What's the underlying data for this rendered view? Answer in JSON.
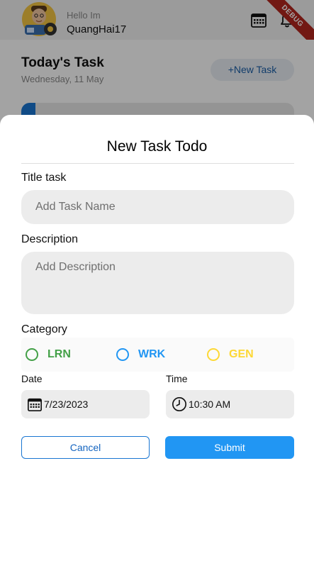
{
  "header": {
    "greeting": "Hello Im",
    "username": "QuangHai17",
    "debug_banner": "DEBUG",
    "icons": [
      "calendar-icon",
      "bell-icon"
    ]
  },
  "home": {
    "title": "Today's Task",
    "date": "Wednesday, 11 May",
    "new_task_label": "+New Task"
  },
  "dialog": {
    "title": "New Task Todo",
    "title_label": "Title task",
    "title_placeholder": "Add Task Name",
    "description_label": "Description",
    "description_placeholder": "Add Description",
    "category_label": "Category",
    "categories": [
      {
        "label": "LRN",
        "color": "#43a047"
      },
      {
        "label": "WRK",
        "color": "#2196f3"
      },
      {
        "label": "GEN",
        "color": "#fdd835"
      }
    ],
    "date_label": "Date",
    "date_value": "7/23/2023",
    "time_label": "Time",
    "time_value": "10:30 AM",
    "cancel_label": "Cancel",
    "submit_label": "Submit"
  },
  "colors": {
    "primary": "#2196f3",
    "accent_dark": "#1565c0",
    "scrim": "rgba(0,0,0,0.36)"
  }
}
